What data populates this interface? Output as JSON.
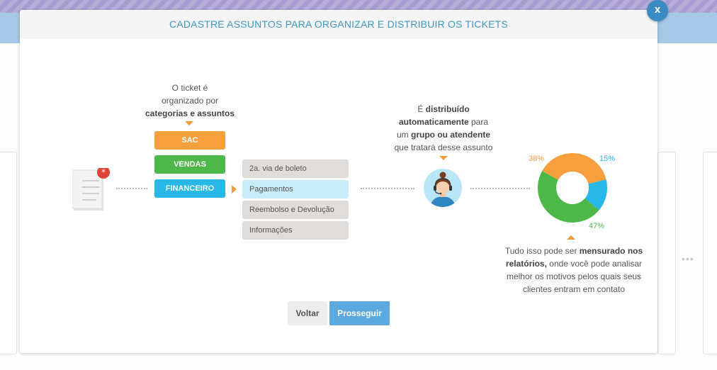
{
  "modal": {
    "title": "CADASTRE ASSUNTOS PARA ORGANIZAR E DISTRIBUIR OS TICKETS",
    "close_label": "x"
  },
  "step1": {
    "line1": "O ticket é",
    "line2": "organizado por",
    "line3": "categorias e assuntos"
  },
  "categories": [
    {
      "label": "SAC",
      "color": "#f5a03c"
    },
    {
      "label": "VENDAS",
      "color": "#4db848"
    },
    {
      "label": "FINANCEIRO",
      "color": "#27b8e8"
    }
  ],
  "subjects": [
    {
      "label": "2a. via de boleto"
    },
    {
      "label": "Pagamentos"
    },
    {
      "label": "Reembolso e Devolução"
    },
    {
      "label": "Informações"
    }
  ],
  "step2": {
    "pre": "É ",
    "bold1": "distribuído",
    "bold2": "automaticamente",
    "after2": " para",
    "line3_pre": "um ",
    "line3_bold": "grupo ou atendente",
    "line4": "que tratará desse assunto"
  },
  "step3": {
    "l1_pre": "Tudo isso pode ser ",
    "l1_bold": "mensurado nos",
    "l2_bold": "relatórios,",
    "l2_after": " onde você pode analisar",
    "l3": "melhor os motivos pelos quais seus",
    "l4": "clientes entram em contato"
  },
  "chart_data": {
    "type": "donut",
    "slices": [
      {
        "label": "38%",
        "value": 38,
        "color": "#f5a03c"
      },
      {
        "label": "15%",
        "value": 15,
        "color": "#27b8e8"
      },
      {
        "label": "47%",
        "value": 47,
        "color": "#4db848"
      }
    ]
  },
  "buttons": {
    "back": "Voltar",
    "next": "Prosseguir"
  },
  "colors": {
    "accent_orange": "#f29a3a",
    "primary_blue": "#5ba9de",
    "header_text": "#3f97c7"
  },
  "background": {
    "more_dots": "•••"
  }
}
